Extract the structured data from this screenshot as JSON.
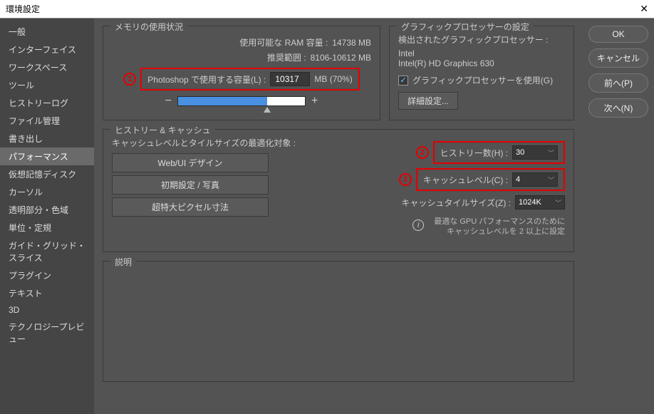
{
  "window": {
    "title": "環境設定"
  },
  "sidebar": {
    "items": [
      "一般",
      "インターフェイス",
      "ワークスペース",
      "ツール",
      "ヒストリーログ",
      "ファイル管理",
      "書き出し",
      "パフォーマンス",
      "仮想記憶ディスク",
      "カーソル",
      "透明部分・色域",
      "単位・定規",
      "ガイド・グリッド・スライス",
      "プラグイン",
      "テキスト",
      "3D",
      "テクノロジープレビュー"
    ],
    "active_index": 7
  },
  "memory": {
    "title": "メモリの使用状況",
    "available_label": "使用可能な RAM 容量 :",
    "available_value": "14738 MB",
    "range_label": "推奨範囲 :",
    "range_value": "8106-10612 MB",
    "use_label": "Photoshop で使用する容量(L) :",
    "use_value": "10317",
    "use_unit": "MB (70%)",
    "minus": "−",
    "plus": "+"
  },
  "gpu": {
    "title": "グラフィックプロセッサーの設定",
    "detected_label": "検出されたグラフィックプロセッサー :",
    "vendor": "Intel",
    "device": "Intel(R) HD Graphics 630",
    "use_gpu_label": "グラフィックプロセッサーを使用(G)",
    "advanced": "詳細設定..."
  },
  "history": {
    "title": "ヒストリー & キャッシュ",
    "opt_label": "キャッシュレベルとタイルサイズの最適化対象 :",
    "btn1": "Web/UI デザイン",
    "btn2": "初期設定 / 写真",
    "btn3": "超特大ピクセル寸法",
    "states_label": "ヒストリー数(H) :",
    "states_value": "30",
    "cache_label": "キャッシュレベル(C) :",
    "cache_value": "4",
    "tile_label": "キャッシュタイルサイズ(Z) :",
    "tile_value": "1024K",
    "hint": "最適な GPU パフォーマンスのために\nキャッシュレベルを 2 以上に設定"
  },
  "desc": {
    "title": "説明"
  },
  "buttons": {
    "ok": "OK",
    "cancel": "キャンセル",
    "prev": "前へ(P)",
    "next": "次へ(N)"
  },
  "badges": [
    "1",
    "2",
    "3"
  ]
}
